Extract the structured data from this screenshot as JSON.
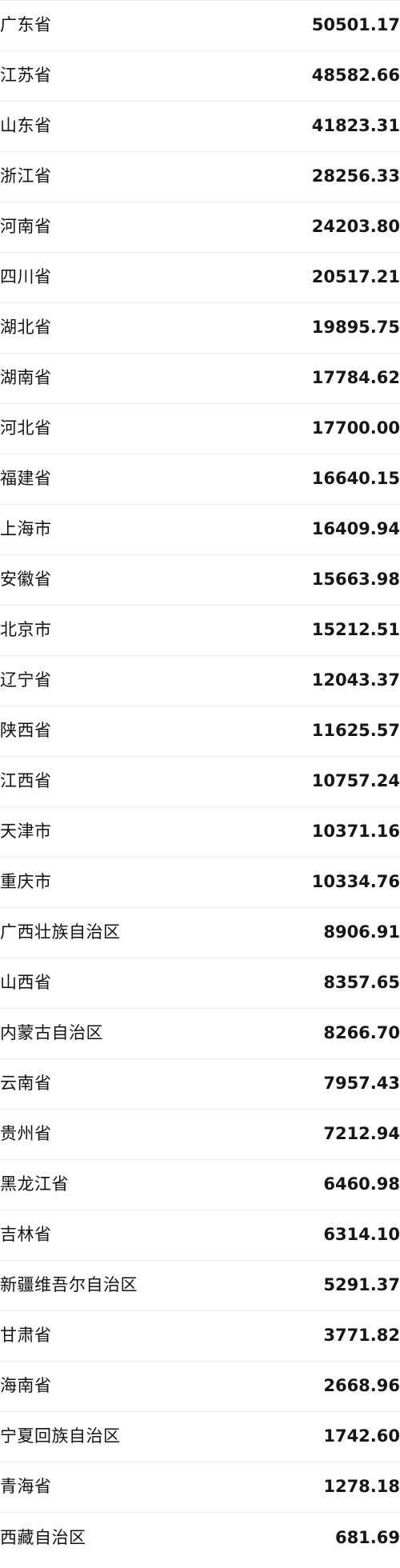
{
  "table": {
    "columns": [
      "region",
      "value"
    ],
    "rows": [
      {
        "region": "广东省",
        "value": "50501.17"
      },
      {
        "region": "江苏省",
        "value": "48582.66"
      },
      {
        "region": "山东省",
        "value": "41823.31"
      },
      {
        "region": "浙江省",
        "value": "28256.33"
      },
      {
        "region": "河南省",
        "value": "24203.80"
      },
      {
        "region": "四川省",
        "value": "20517.21"
      },
      {
        "region": "湖北省",
        "value": "19895.75"
      },
      {
        "region": "湖南省",
        "value": "17784.62"
      },
      {
        "region": "河北省",
        "value": "17700.00"
      },
      {
        "region": "福建省",
        "value": "16640.15"
      },
      {
        "region": "上海市",
        "value": "16409.94"
      },
      {
        "region": "安徽省",
        "value": "15663.98"
      },
      {
        "region": "北京市",
        "value": "15212.51"
      },
      {
        "region": "辽宁省",
        "value": "12043.37"
      },
      {
        "region": "陕西省",
        "value": "11625.57"
      },
      {
        "region": "江西省",
        "value": "10757.24"
      },
      {
        "region": "天津市",
        "value": "10371.16"
      },
      {
        "region": "重庆市",
        "value": "10334.76"
      },
      {
        "region": "广西壮族自治区",
        "value": "8906.91"
      },
      {
        "region": "山西省",
        "value": "8357.65"
      },
      {
        "region": "内蒙古自治区",
        "value": "8266.70"
      },
      {
        "region": "云南省",
        "value": "7957.43"
      },
      {
        "region": "贵州省",
        "value": "7212.94"
      },
      {
        "region": "黑龙江省",
        "value": "6460.98"
      },
      {
        "region": "吉林省",
        "value": "6314.10"
      },
      {
        "region": "新疆维吾尔自治区",
        "value": "5291.37"
      },
      {
        "region": "甘肃省",
        "value": "3771.82"
      },
      {
        "region": "海南省",
        "value": "2668.96"
      },
      {
        "region": "宁夏回族自治区",
        "value": "1742.60"
      },
      {
        "region": "青海省",
        "value": "1278.18"
      },
      {
        "region": "西藏自治区",
        "value": "681.69"
      }
    ]
  },
  "chart_data": {
    "type": "table",
    "title": "",
    "xlabel": "",
    "ylabel": "",
    "categories": [
      "广东省",
      "江苏省",
      "山东省",
      "浙江省",
      "河南省",
      "四川省",
      "湖北省",
      "湖南省",
      "河北省",
      "福建省",
      "上海市",
      "安徽省",
      "北京市",
      "辽宁省",
      "陕西省",
      "江西省",
      "天津市",
      "重庆市",
      "广西壮族自治区",
      "山西省",
      "内蒙古自治区",
      "云南省",
      "贵州省",
      "黑龙江省",
      "吉林省",
      "新疆维吾尔自治区",
      "甘肃省",
      "海南省",
      "宁夏回族自治区",
      "青海省",
      "西藏自治区"
    ],
    "values": [
      50501.17,
      48582.66,
      41823.31,
      28256.33,
      24203.8,
      20517.21,
      19895.75,
      17784.62,
      17700.0,
      16640.15,
      16409.94,
      15663.98,
      15212.51,
      12043.37,
      11625.57,
      10757.24,
      10371.16,
      10334.76,
      8906.91,
      8357.65,
      8266.7,
      7957.43,
      7212.94,
      6460.98,
      6314.1,
      5291.37,
      3771.82,
      2668.96,
      1742.6,
      1278.18,
      681.69
    ],
    "sort": "descending",
    "row_count": 31
  },
  "style": {
    "separator_color": "#eceded",
    "text_color": "#121212",
    "background_color": "#ffffff"
  }
}
